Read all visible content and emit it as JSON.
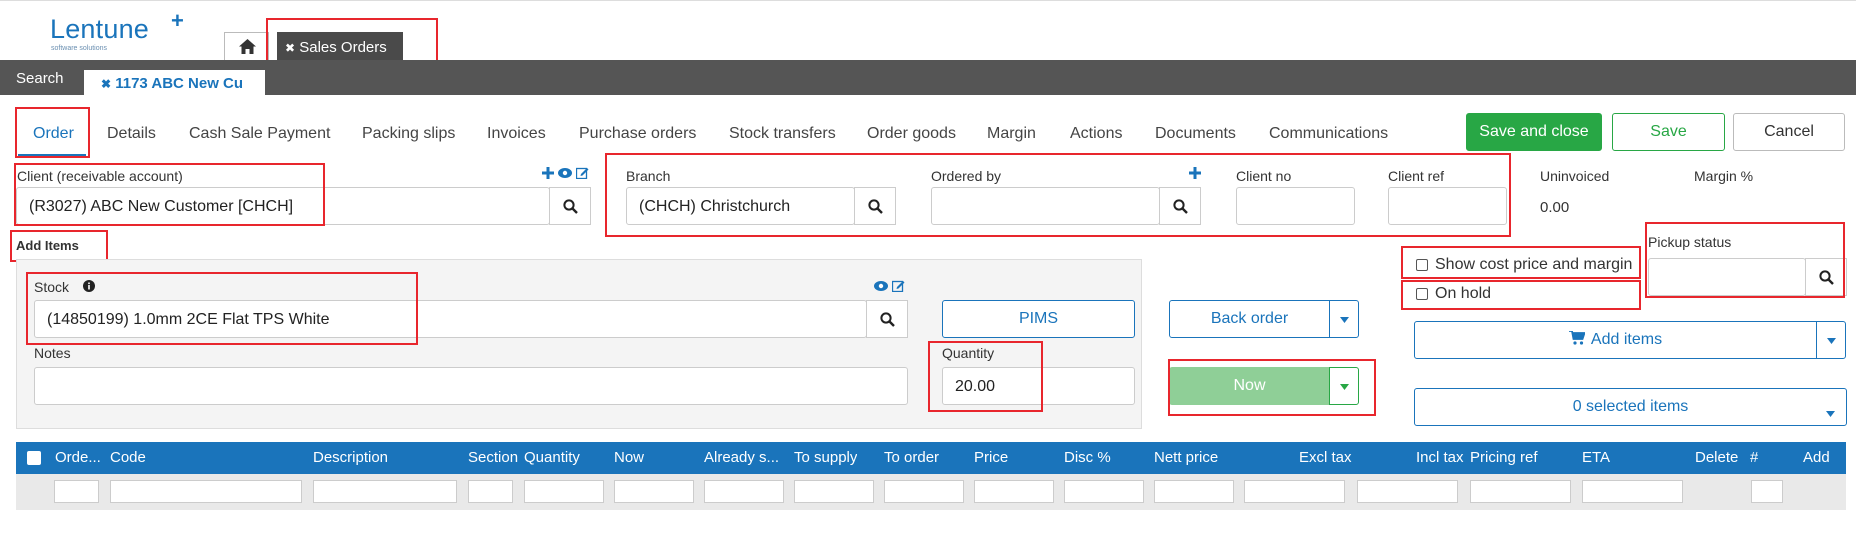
{
  "brand": {
    "name": "Lentune",
    "plus": "+",
    "tagline": "software solutions"
  },
  "header": {
    "home_icon": "home-icon",
    "module_tab": "Sales Orders",
    "module_tab_close": "✖"
  },
  "darkbar": {
    "search": "Search",
    "order_tab": "1173 ABC New Cu",
    "order_tab_close": "✖"
  },
  "nav": [
    "Order",
    "Details",
    "Cash Sale Payment",
    "Packing slips",
    "Invoices",
    "Purchase orders",
    "Stock transfers",
    "Order goods",
    "Margin",
    "Actions",
    "Documents",
    "Communications"
  ],
  "actions": {
    "save_close": "Save and close",
    "save": "Save",
    "cancel": "Cancel"
  },
  "client": {
    "label": "Client (receivable account)",
    "value": "(R3027) ABC New Customer [CHCH]"
  },
  "branch": {
    "label": "Branch",
    "value": "(CHCH) Christchurch"
  },
  "ordered_by": {
    "label": "Ordered by",
    "value": ""
  },
  "client_no": {
    "label": "Client no",
    "value": ""
  },
  "client_ref": {
    "label": "Client ref",
    "value": ""
  },
  "uninvoiced": {
    "label": "Uninvoiced",
    "value": "0.00"
  },
  "margin": {
    "label": "Margin %"
  },
  "add_items_heading": "Add Items",
  "stock": {
    "label": "Stock",
    "value": "(14850199) 1.0mm 2CE Flat TPS White"
  },
  "notes": {
    "label": "Notes",
    "value": ""
  },
  "quantity": {
    "label": "Quantity",
    "value": "20.00"
  },
  "buttons": {
    "pims": "PIMS",
    "back_order": "Back order",
    "now": "Now",
    "add_items": "Add items",
    "selected_items": "0 selected items"
  },
  "options": {
    "show_cost": "Show cost price and margin",
    "on_hold": "On hold"
  },
  "pickup": {
    "label": "Pickup status",
    "value": ""
  },
  "table": {
    "columns": [
      "Orde...",
      "Code",
      "Description",
      "Section",
      "Quantity",
      "Now",
      "Already s...",
      "To supply",
      "To order",
      "Price",
      "Disc %",
      "Nett price",
      "Excl tax",
      "Incl tax",
      "Pricing ref",
      "ETA",
      "Delete",
      "#",
      "Add"
    ]
  },
  "colors": {
    "brand_blue": "#1a74bb",
    "green": "#28a745",
    "dark_bar": "#555555",
    "highlight_red": "#e8262d"
  }
}
